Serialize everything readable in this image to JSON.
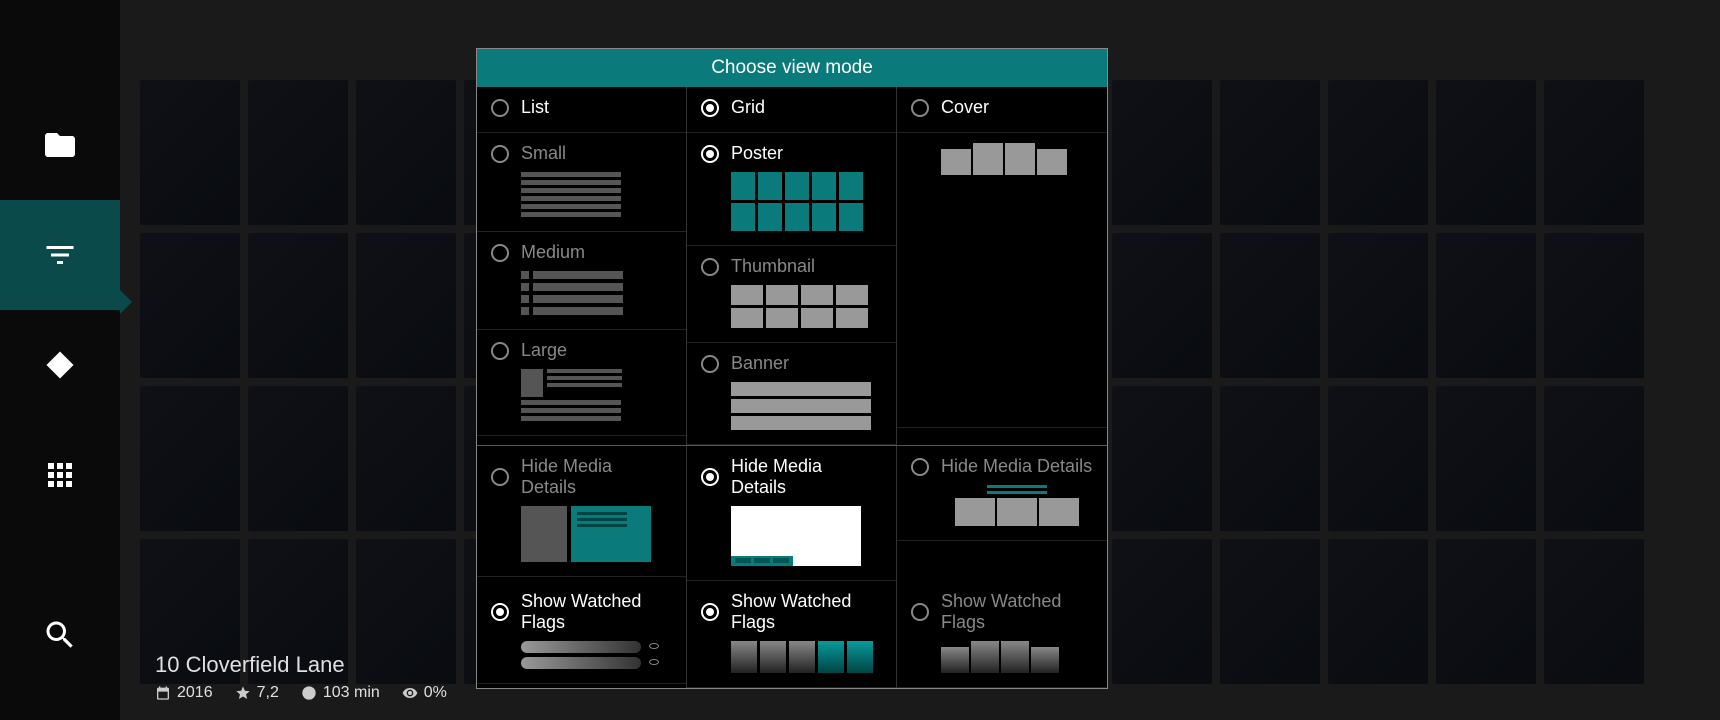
{
  "sidebar": {
    "items": [
      {
        "name": "folder",
        "label": "Browse"
      },
      {
        "name": "filter",
        "label": "Filter"
      },
      {
        "name": "tag",
        "label": "Tags"
      },
      {
        "name": "grid",
        "label": "Grid"
      },
      {
        "name": "search",
        "label": "Search"
      }
    ]
  },
  "modal": {
    "title": "Choose view mode",
    "columns": {
      "list": {
        "header": "List",
        "options": [
          "Small",
          "Medium",
          "Large"
        ]
      },
      "grid": {
        "header": "Grid",
        "options": [
          "Poster",
          "Thumbnail",
          "Banner"
        ]
      },
      "cover": {
        "header": "Cover"
      }
    },
    "details_row": {
      "hide_label": "Hide Media Details",
      "show_flags_label": "Show Watched Flags"
    }
  },
  "selected": {
    "title": "10 Cloverfield Lane",
    "year": "2016",
    "rating": "7,2",
    "duration": "103 min",
    "watched": "0%"
  }
}
